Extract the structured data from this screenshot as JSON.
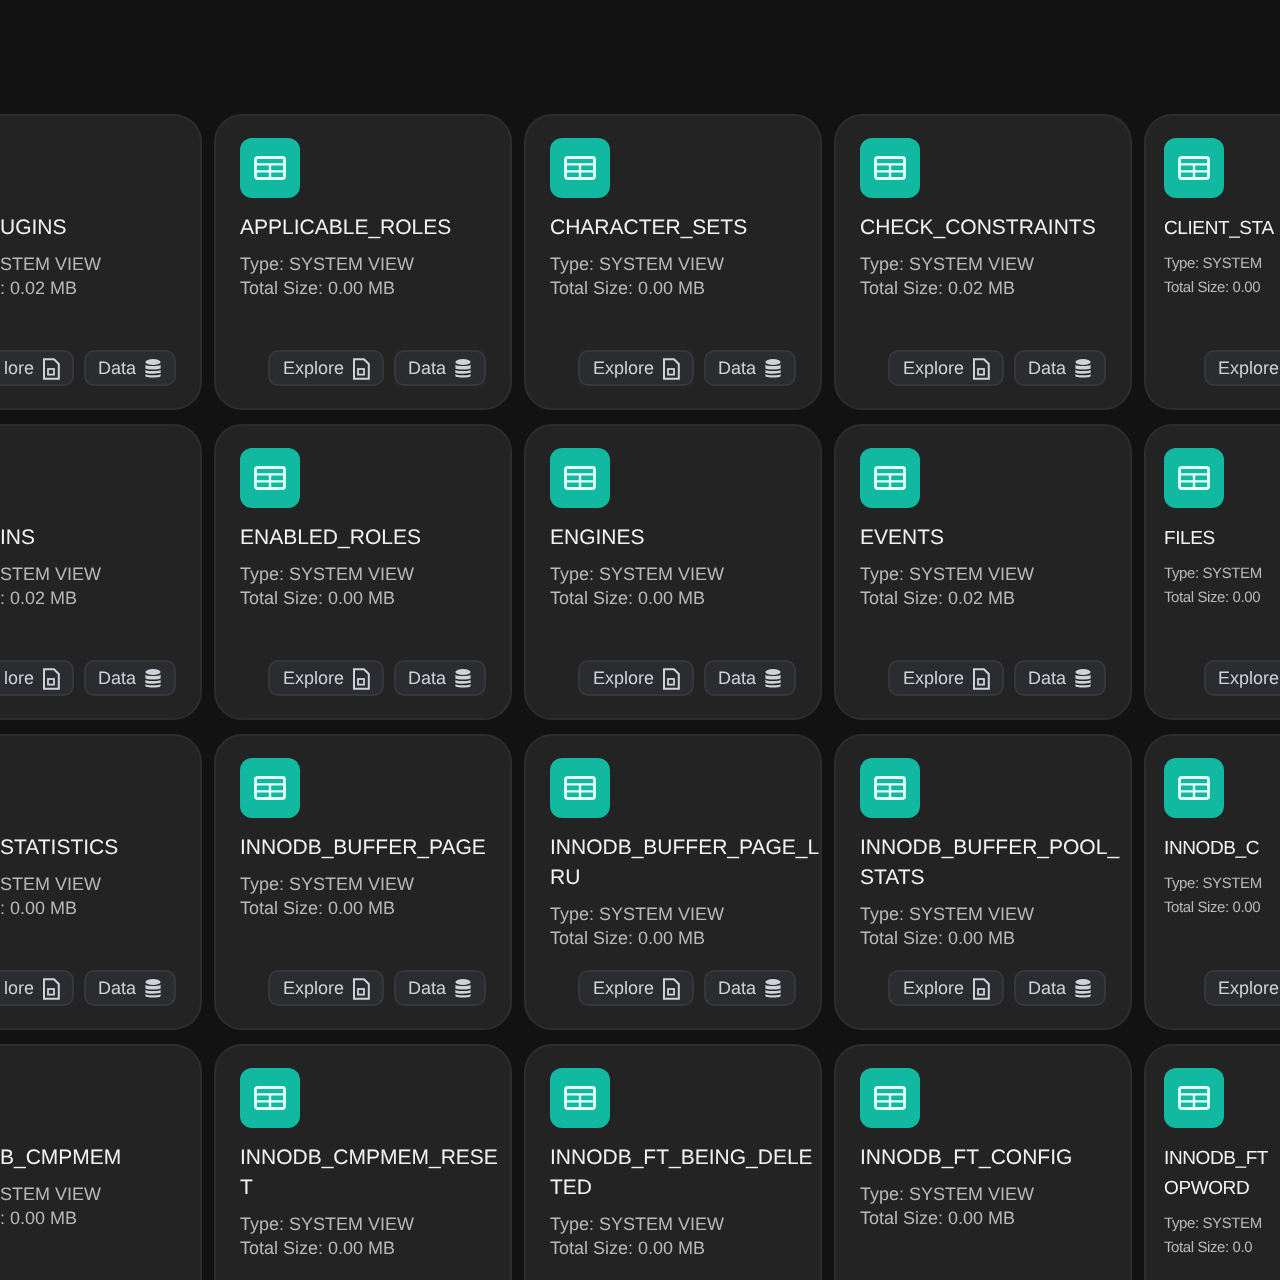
{
  "rows": [
    {
      "cards": [
        {
          "kind": "cut_left",
          "title_lines": [
            "UGINS"
          ],
          "type": "STEM VIEW",
          "size": ": 0.02 MB",
          "buttons": [
            {
              "label": "lore",
              "kind": "explore"
            },
            {
              "label": "Data",
              "kind": "data"
            }
          ]
        },
        {
          "kind": "full",
          "title_lines": [
            "APPLICABLE_ROLES"
          ],
          "type": "Type: SYSTEM VIEW",
          "size": "Total Size: 0.00 MB",
          "buttons": [
            {
              "label": "Explore",
              "kind": "explore"
            },
            {
              "label": "Data",
              "kind": "data"
            }
          ]
        },
        {
          "kind": "full",
          "title_lines": [
            "CHARACTER_SETS"
          ],
          "type": "Type: SYSTEM VIEW",
          "size": "Total Size: 0.00 MB",
          "buttons": [
            {
              "label": "Explore",
              "kind": "explore"
            },
            {
              "label": "Data",
              "kind": "data"
            }
          ]
        },
        {
          "kind": "full",
          "title_lines": [
            "CHECK_CONSTRAINTS"
          ],
          "type": "Type: SYSTEM VIEW",
          "size": "Total Size: 0.02 MB",
          "buttons": [
            {
              "label": "Explore",
              "kind": "explore"
            },
            {
              "label": "Data",
              "kind": "data"
            }
          ]
        },
        {
          "kind": "cut_right",
          "title_lines": [
            "CLIENT_STA"
          ],
          "type": "Type: SYSTEM",
          "size": "Total Size: 0.00",
          "buttons": [
            {
              "label": "Explore",
              "kind": "explore"
            }
          ]
        }
      ]
    },
    {
      "cards": [
        {
          "kind": "cut_left",
          "title_lines": [
            "INS"
          ],
          "type": "STEM VIEW",
          "size": ": 0.02 MB",
          "buttons": [
            {
              "label": "lore",
              "kind": "explore"
            },
            {
              "label": "Data",
              "kind": "data"
            }
          ]
        },
        {
          "kind": "full",
          "title_lines": [
            "ENABLED_ROLES"
          ],
          "type": "Type: SYSTEM VIEW",
          "size": "Total Size: 0.00 MB",
          "buttons": [
            {
              "label": "Explore",
              "kind": "explore"
            },
            {
              "label": "Data",
              "kind": "data"
            }
          ]
        },
        {
          "kind": "full",
          "title_lines": [
            "ENGINES"
          ],
          "type": "Type: SYSTEM VIEW",
          "size": "Total Size: 0.00 MB",
          "buttons": [
            {
              "label": "Explore",
              "kind": "explore"
            },
            {
              "label": "Data",
              "kind": "data"
            }
          ]
        },
        {
          "kind": "full",
          "title_lines": [
            "EVENTS"
          ],
          "type": "Type: SYSTEM VIEW",
          "size": "Total Size: 0.02 MB",
          "buttons": [
            {
              "label": "Explore",
              "kind": "explore"
            },
            {
              "label": "Data",
              "kind": "data"
            }
          ]
        },
        {
          "kind": "cut_right",
          "title_lines": [
            "FILES"
          ],
          "type": "Type: SYSTEM",
          "size": "Total Size: 0.00",
          "buttons": [
            {
              "label": "Explore",
              "kind": "explore"
            }
          ]
        }
      ]
    },
    {
      "cards": [
        {
          "kind": "cut_left",
          "title_lines": [
            "STATISTICS"
          ],
          "type": "STEM VIEW",
          "size": ": 0.00 MB",
          "buttons": [
            {
              "label": "lore",
              "kind": "explore"
            },
            {
              "label": "Data",
              "kind": "data"
            }
          ]
        },
        {
          "kind": "full",
          "title_lines": [
            "INNODB_BUFFER_PAGE"
          ],
          "type": "Type: SYSTEM VIEW",
          "size": "Total Size: 0.00 MB",
          "buttons": [
            {
              "label": "Explore",
              "kind": "explore"
            },
            {
              "label": "Data",
              "kind": "data"
            }
          ]
        },
        {
          "kind": "full",
          "title_lines": [
            "INNODB_BUFFER_PAGE_L",
            "RU"
          ],
          "type": "Type: SYSTEM VIEW",
          "size": "Total Size: 0.00 MB",
          "buttons": [
            {
              "label": "Explore",
              "kind": "explore"
            },
            {
              "label": "Data",
              "kind": "data"
            }
          ]
        },
        {
          "kind": "full",
          "title_lines": [
            "INNODB_BUFFER_POOL_",
            "STATS"
          ],
          "type": "Type: SYSTEM VIEW",
          "size": "Total Size: 0.00 MB",
          "buttons": [
            {
              "label": "Explore",
              "kind": "explore"
            },
            {
              "label": "Data",
              "kind": "data"
            }
          ]
        },
        {
          "kind": "cut_right",
          "title_lines": [
            "INNODB_C"
          ],
          "type": "Type: SYSTEM",
          "size": "Total Size: 0.00",
          "buttons": [
            {
              "label": "Explore",
              "kind": "explore"
            }
          ]
        }
      ]
    },
    {
      "cards": [
        {
          "kind": "cut_left",
          "title_lines": [
            "B_CMPMEM"
          ],
          "type": "STEM VIEW",
          "size": ": 0.00 MB"
        },
        {
          "kind": "full",
          "title_lines": [
            "INNODB_CMPMEM_RESE",
            "T"
          ],
          "type": "Type: SYSTEM VIEW",
          "size": "Total Size: 0.00 MB"
        },
        {
          "kind": "full",
          "title_lines": [
            "INNODB_FT_BEING_DELE",
            "TED"
          ],
          "type": "Type: SYSTEM VIEW",
          "size": "Total Size: 0.00 MB"
        },
        {
          "kind": "full",
          "title_lines": [
            "INNODB_FT_CONFIG"
          ],
          "type": "Type: SYSTEM VIEW",
          "size": "Total Size: 0.00 MB"
        },
        {
          "kind": "cut_right",
          "title_lines": [
            "INNODB_FT",
            "OPWORD"
          ],
          "type": "Type: SYSTEM",
          "size": "Total Size: 0.0"
        }
      ]
    }
  ]
}
